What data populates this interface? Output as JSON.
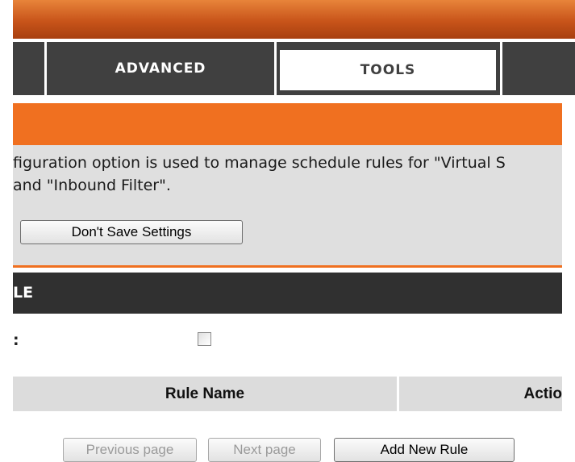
{
  "tabs": {
    "advanced": "ADVANCED",
    "tools": "TOOLS"
  },
  "intro": {
    "line1": "figuration option is used to manage schedule rules for \"Virtual S",
    "line2": "and \"Inbound Filter\"."
  },
  "buttons": {
    "dont_save": "Don't Save Settings",
    "previous_page": "Previous page",
    "next_page": "Next page",
    "add_new_rule": "Add New Rule"
  },
  "section": {
    "title": "LE",
    "enable_label": ":",
    "enable_checked": false
  },
  "table": {
    "columns": [
      "Rule Name",
      "Actio"
    ]
  },
  "colors": {
    "accent_orange": "#f07020",
    "dark_header": "#303030",
    "tab_bar": "#404040",
    "panel_gray": "#dfdfdf"
  }
}
